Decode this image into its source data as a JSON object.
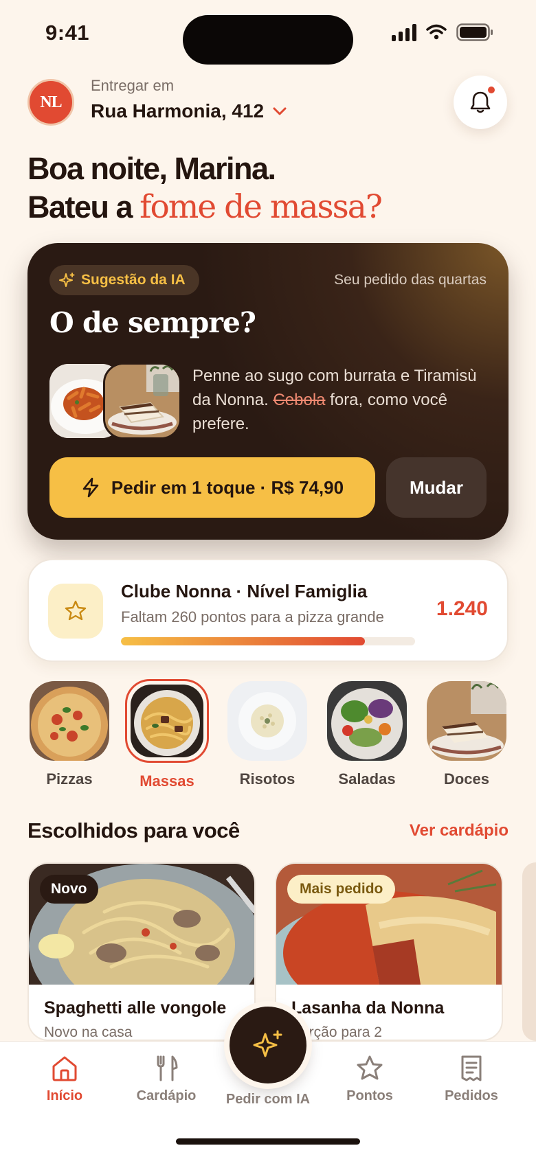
{
  "status": {
    "time": "9:41"
  },
  "header": {
    "logo_text": "NL",
    "deliver_label": "Entregar em",
    "address": "Rua Harmonia, 412"
  },
  "greeting": {
    "line1": "Boa noite, Marina.",
    "line2_prefix": "Bateu a",
    "line2_accent": "fome de massa?"
  },
  "ai_card": {
    "chip": "Sugestão da IA",
    "note": "Seu pedido das quartas",
    "title": "O de sempre?",
    "desc_part1": "Penne ao sugo com burrata e Tiramisù da Nonna.",
    "desc_strike": "Cebola",
    "desc_part2": "fora, como você prefere.",
    "order_button": "Pedir em 1 toque · R$ 74,90",
    "change_button": "Mudar"
  },
  "club": {
    "title": "Clube Nonna · Nível Famiglia",
    "subtitle": "Faltam 260 pontos para a pizza grande",
    "points": "1.240",
    "progress_fraction": 0.83
  },
  "categories": [
    {
      "label": "Pizzas",
      "active": false
    },
    {
      "label": "Massas",
      "active": true
    },
    {
      "label": "Risotos",
      "active": false
    },
    {
      "label": "Saladas",
      "active": false
    },
    {
      "label": "Doces",
      "active": false
    }
  ],
  "section": {
    "title": "Escolhidos para você",
    "link": "Ver cardápio"
  },
  "dishes": [
    {
      "badge": "Novo",
      "name": "Spaghetti alle vongole",
      "subtitle": "Novo na casa"
    },
    {
      "badge": "Mais pedido",
      "name": "Lasanha da Nonna",
      "subtitle": "Porção para 2"
    }
  ],
  "nav": {
    "home": "Início",
    "menu": "Cardápio",
    "ai": "Pedir com IA",
    "points": "Pontos",
    "orders": "Pedidos"
  },
  "colors": {
    "accent": "#e14a32",
    "gold": "#f6bf45",
    "dark": "#2a1a13",
    "background": "#fdf5ec"
  }
}
